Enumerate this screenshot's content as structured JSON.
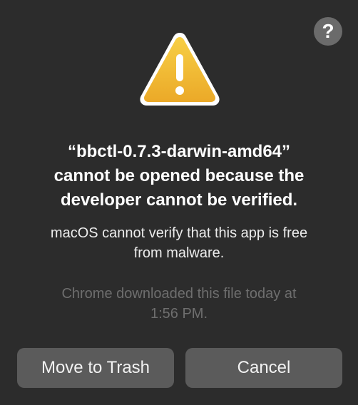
{
  "dialog": {
    "help_label": "?",
    "icon": "warning-triangle-icon",
    "accent_color": "#f2b836",
    "title_lines": [
      "“bbctl-0.7.3-darwin-amd64”",
      "cannot be opened because the",
      "developer cannot be verified."
    ],
    "message_lines": [
      "macOS cannot verify that this app is free",
      "from malware."
    ],
    "source_note_lines": [
      "Chrome downloaded this file today at",
      "1:56 PM."
    ],
    "buttons": {
      "trash_label": "Move to Trash",
      "cancel_label": "Cancel"
    }
  }
}
